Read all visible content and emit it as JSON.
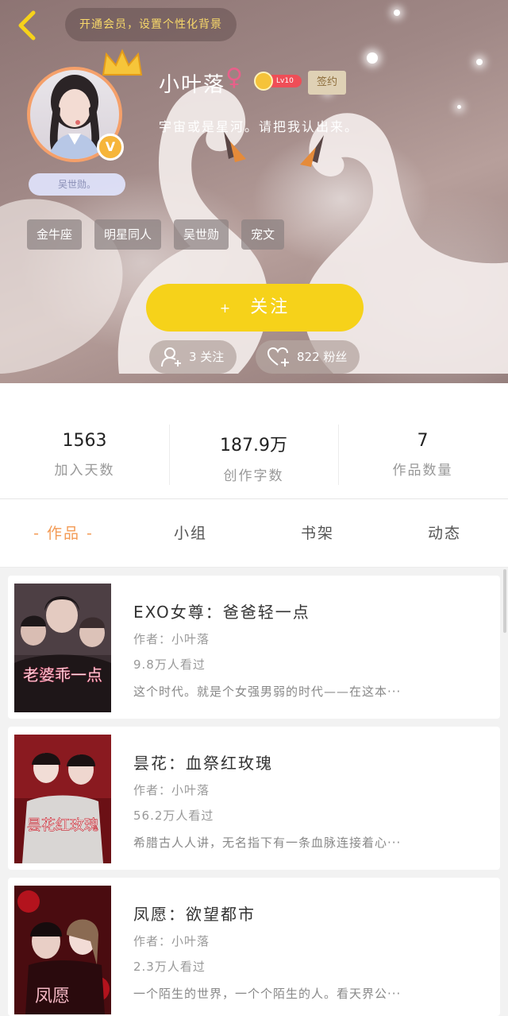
{
  "header": {
    "vip_banner": "开通会员，设置个性化背景",
    "username": "小叶落",
    "gender_symbol": "♀",
    "level": "Lv10",
    "sign_badge": "签约",
    "motto": "宇宙或是星河。请把我认出来。",
    "avatar_tag": "吴世勋。",
    "avatar_badge": "V",
    "tags": [
      "金牛座",
      "明星同人",
      "吴世勋",
      "宠文"
    ],
    "follow_label": "关注",
    "follow_plus": "+",
    "following": "3 关注",
    "fans": "822 粉丝"
  },
  "stats": [
    {
      "value": "1563",
      "label": "加入天数"
    },
    {
      "value": "187.9万",
      "label": "创作字数"
    },
    {
      "value": "7",
      "label": "作品数量"
    }
  ],
  "tabs": [
    "- 作品 -",
    "小组",
    "书架",
    "动态"
  ],
  "books": [
    {
      "title": "EXO女尊：爸爸轻一点",
      "author": "作者：小叶落",
      "views": "9.8万人看过",
      "desc": "这个时代。就是个女强男弱的时代——在这本···",
      "cover_text": "老婆乖一点"
    },
    {
      "title": "昙花：血祭红玫瑰",
      "author": "作者：小叶落",
      "views": "56.2万人看过",
      "desc": "希腊古人人讲，无名指下有一条血脉连接着心···",
      "cover_text": "昙花红玫瑰"
    },
    {
      "title": "凤愿：欲望都市",
      "author": "作者：小叶落",
      "views": "2.3万人看过",
      "desc": "一个陌生的世界，一个个陌生的人。看天界公···",
      "cover_text": "凤愿"
    }
  ],
  "colors": {
    "accent": "#f39a54",
    "follow": "#f6d21a",
    "vip_text": "#f8d86a"
  }
}
